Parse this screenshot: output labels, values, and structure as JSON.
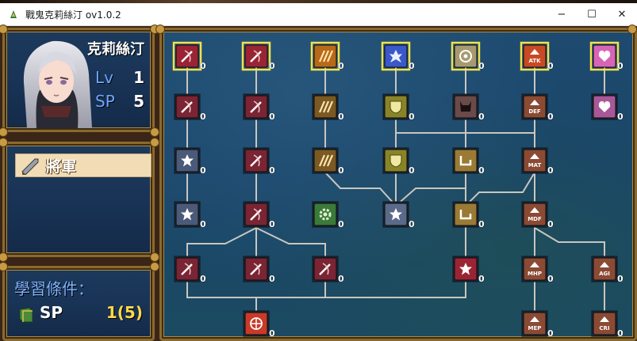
{
  "window": {
    "title": "戰鬼克莉絲汀 ov1.0.2",
    "controls": {
      "minimize": "−",
      "maximize": "☐",
      "close": "✕"
    }
  },
  "character": {
    "name": "克莉絲汀",
    "lv_label": "Lv",
    "lv_value": "1",
    "sp_label": "SP",
    "sp_value": "5"
  },
  "class_panel": {
    "selected_class": "將軍"
  },
  "requirement": {
    "title": "學習條件：",
    "label": "SP",
    "value": "1(5)"
  },
  "colors": {
    "selected_border": "#f2e24a",
    "link_line": "#c9c6bf",
    "count_text": "#ffffff",
    "stat_label": "#6fa6ff",
    "requirement_value": "#ffd84a"
  },
  "skill_tree": {
    "nodes": [
      {
        "id": "n1",
        "col": 0,
        "row": 0,
        "icon": "sword-slash-icon",
        "bg": "#9a2434",
        "count": "0",
        "selected": true
      },
      {
        "id": "n2",
        "col": 1,
        "row": 0,
        "icon": "sword-slash-icon",
        "bg": "#9a2434",
        "count": "0",
        "selected": true
      },
      {
        "id": "n3",
        "col": 2,
        "row": 0,
        "icon": "claw-icon",
        "bg": "#b86a18",
        "count": "0",
        "selected": true
      },
      {
        "id": "n4",
        "col": 3,
        "row": 0,
        "icon": "burst-icon",
        "bg": "#3a58c8",
        "count": "0",
        "selected": true
      },
      {
        "id": "n5",
        "col": 4,
        "row": 0,
        "icon": "focus-icon",
        "bg": "#a89a70",
        "count": "0",
        "selected": true
      },
      {
        "id": "n6",
        "col": 5,
        "row": 0,
        "icon": "atk-up-icon",
        "bg": "#c84a24",
        "count": "0",
        "selected": true,
        "text": "ATK"
      },
      {
        "id": "n7",
        "col": 6,
        "row": 0,
        "icon": "heart-icon",
        "bg": "#d864b8",
        "count": "0",
        "selected": true
      },
      {
        "id": "n8",
        "col": 0,
        "row": 1,
        "icon": "sword-slash-icon",
        "bg": "#7a2434",
        "count": "0"
      },
      {
        "id": "n9",
        "col": 1,
        "row": 1,
        "icon": "sword-slash-icon",
        "bg": "#7a2434",
        "count": "0"
      },
      {
        "id": "n10",
        "col": 2,
        "row": 1,
        "icon": "claw-icon",
        "bg": "#7a5a22",
        "count": "0"
      },
      {
        "id": "n11",
        "col": 3,
        "row": 1,
        "icon": "shield-icon",
        "bg": "#8a8428",
        "count": "0"
      },
      {
        "id": "n12",
        "col": 4,
        "row": 1,
        "icon": "demon-icon",
        "bg": "#6a4a4a",
        "count": "0"
      },
      {
        "id": "n13",
        "col": 5,
        "row": 1,
        "icon": "def-up-icon",
        "bg": "#8a4a34",
        "count": "0",
        "text": "DEF"
      },
      {
        "id": "n14",
        "col": 6,
        "row": 1,
        "icon": "heart-icon",
        "bg": "#a85898",
        "count": "0"
      },
      {
        "id": "n15",
        "col": 0,
        "row": 2,
        "icon": "star-icon",
        "bg": "#4a5a78",
        "count": "0"
      },
      {
        "id": "n16",
        "col": 1,
        "row": 2,
        "icon": "sword-slash-icon",
        "bg": "#7a2434",
        "count": "0"
      },
      {
        "id": "n17",
        "col": 2,
        "row": 2,
        "icon": "claw-icon",
        "bg": "#7a5a22",
        "count": "0"
      },
      {
        "id": "n18",
        "col": 3,
        "row": 2,
        "icon": "shield-icon",
        "bg": "#8a8428",
        "count": "0"
      },
      {
        "id": "n19",
        "col": 4,
        "row": 2,
        "icon": "return-arrow-icon",
        "bg": "#9a7a34",
        "count": "0"
      },
      {
        "id": "n20",
        "col": 5,
        "row": 2,
        "icon": "mat-up-icon",
        "bg": "#8a4a34",
        "count": "0",
        "text": "MAT"
      },
      {
        "id": "n21",
        "col": 0,
        "row": 3,
        "icon": "star-icon",
        "bg": "#4a5a78",
        "count": "0"
      },
      {
        "id": "n22",
        "col": 1,
        "row": 3,
        "icon": "sword-slash-icon",
        "bg": "#7a2434",
        "count": "0"
      },
      {
        "id": "n23",
        "col": 2,
        "row": 3,
        "icon": "gear-icon",
        "bg": "#3a7a3a",
        "count": "0"
      },
      {
        "id": "n24",
        "col": 3,
        "row": 3,
        "icon": "star-icon",
        "bg": "#5a6a88",
        "count": "0"
      },
      {
        "id": "n25",
        "col": 4,
        "row": 3,
        "icon": "return-arrow-icon",
        "bg": "#9a7a34",
        "count": "0"
      },
      {
        "id": "n26",
        "col": 5,
        "row": 3,
        "icon": "mdf-up-icon",
        "bg": "#8a4a34",
        "count": "0",
        "text": "MDF"
      },
      {
        "id": "n27",
        "col": 0,
        "row": 4,
        "icon": "sword-slash-icon",
        "bg": "#7a2434",
        "count": "0"
      },
      {
        "id": "n28",
        "col": 1,
        "row": 4,
        "icon": "sword-slash-icon",
        "bg": "#7a2434",
        "count": "0"
      },
      {
        "id": "n29",
        "col": 2,
        "row": 4,
        "icon": "sword-slash-icon",
        "bg": "#7a2434",
        "count": "0"
      },
      {
        "id": "n30",
        "col": 4,
        "row": 4,
        "icon": "star-icon",
        "bg": "#9a2434",
        "count": "0"
      },
      {
        "id": "n31",
        "col": 5,
        "row": 4,
        "icon": "mhp-up-icon",
        "bg": "#8a4a34",
        "count": "0",
        "text": "MHP"
      },
      {
        "id": "n32",
        "col": 6,
        "row": 4,
        "icon": "agi-up-icon",
        "bg": "#8a4a34",
        "count": "0",
        "text": "AGI"
      },
      {
        "id": "n33",
        "col": 1,
        "row": 5,
        "icon": "target-icon",
        "bg": "#c83a2a",
        "count": "0"
      },
      {
        "id": "n34",
        "col": 5,
        "row": 5,
        "icon": "mep-up-icon",
        "bg": "#8a4a34",
        "count": "0",
        "text": "MEP"
      },
      {
        "id": "n35",
        "col": 6,
        "row": 5,
        "icon": "cri-up-icon",
        "bg": "#8a4a34",
        "count": "0",
        "text": "CRI"
      }
    ]
  }
}
